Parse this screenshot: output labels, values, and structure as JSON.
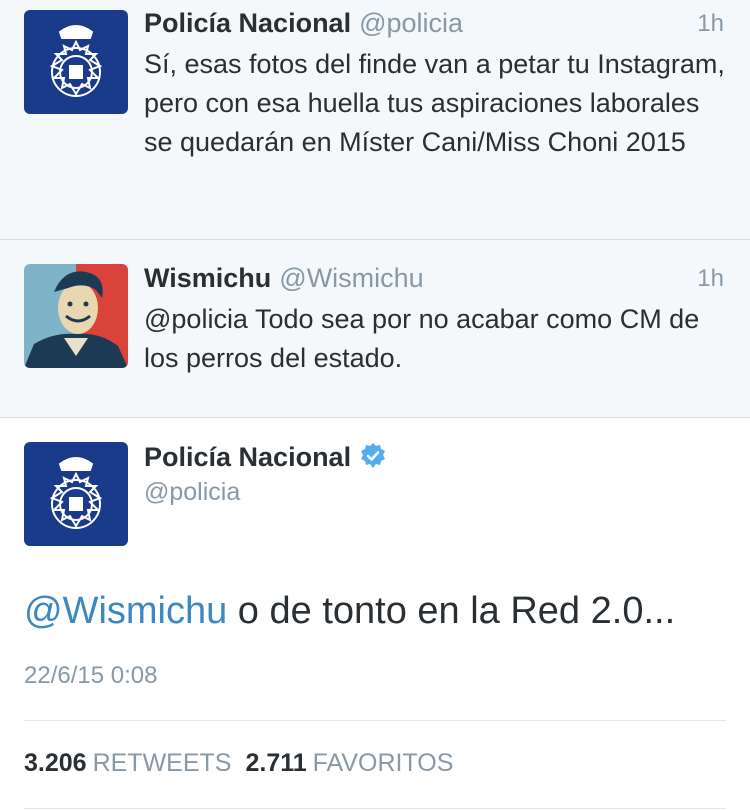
{
  "tweets": [
    {
      "name": "Policía Nacional",
      "handle": "@policia",
      "time": "1h",
      "text": "Sí, esas fotos del finde van a petar tu Instagram, pero con esa huella tus aspiraciones laborales se quedarán en Míster Cani/Miss Choni 2015",
      "avatar": "policia-badge-icon"
    },
    {
      "name": "Wismichu",
      "handle": "@Wismichu",
      "time": "1h",
      "text": "@policia Todo sea por no acabar como CM de los perros del estado.",
      "avatar": "wismichu-profile-photo"
    }
  ],
  "detail": {
    "name": "Policía Nacional",
    "handle": "@policia",
    "verified": true,
    "mention": "@Wismichu",
    "text": " o de tonto en la Red 2.0...",
    "date": "22/6/15 0:08",
    "retweets_count": "3.206",
    "retweets_label": "RETWEETS",
    "favorites_count": "2.711",
    "favorites_label": "FAVORITOS"
  },
  "colors": {
    "text": "#292f33",
    "secondary": "#8899a6",
    "link": "#3b88c3",
    "badge_blue": "#1a3a8a",
    "verified": "#55acee"
  }
}
